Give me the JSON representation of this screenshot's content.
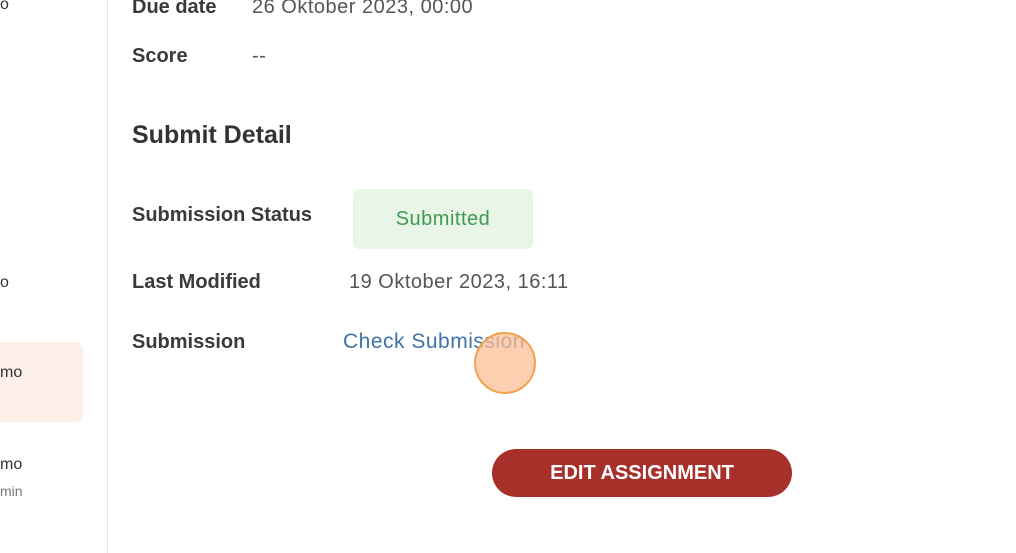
{
  "sidebar": {
    "fragments": [
      "o",
      "o",
      "mo",
      "mo",
      "min"
    ]
  },
  "assignment": {
    "due_date_label": "Due date",
    "due_date_value": "26 Oktober 2023, 00:00",
    "score_label": "Score",
    "score_value": "--"
  },
  "submit_detail": {
    "title": "Submit Detail",
    "status_label": "Submission Status",
    "status_value": "Submitted",
    "last_modified_label": "Last Modified",
    "last_modified_value": "19 Oktober 2023, 16:11",
    "submission_label": "Submission",
    "submission_link": "Check Submission"
  },
  "actions": {
    "edit_label": "EDIT ASSIGNMENT"
  },
  "colors": {
    "accent": "#a8302a",
    "status_bg": "#e9f5e6",
    "status_text": "#3f9a52",
    "link": "#3f73a8",
    "highlight": "#fcf0e8"
  }
}
